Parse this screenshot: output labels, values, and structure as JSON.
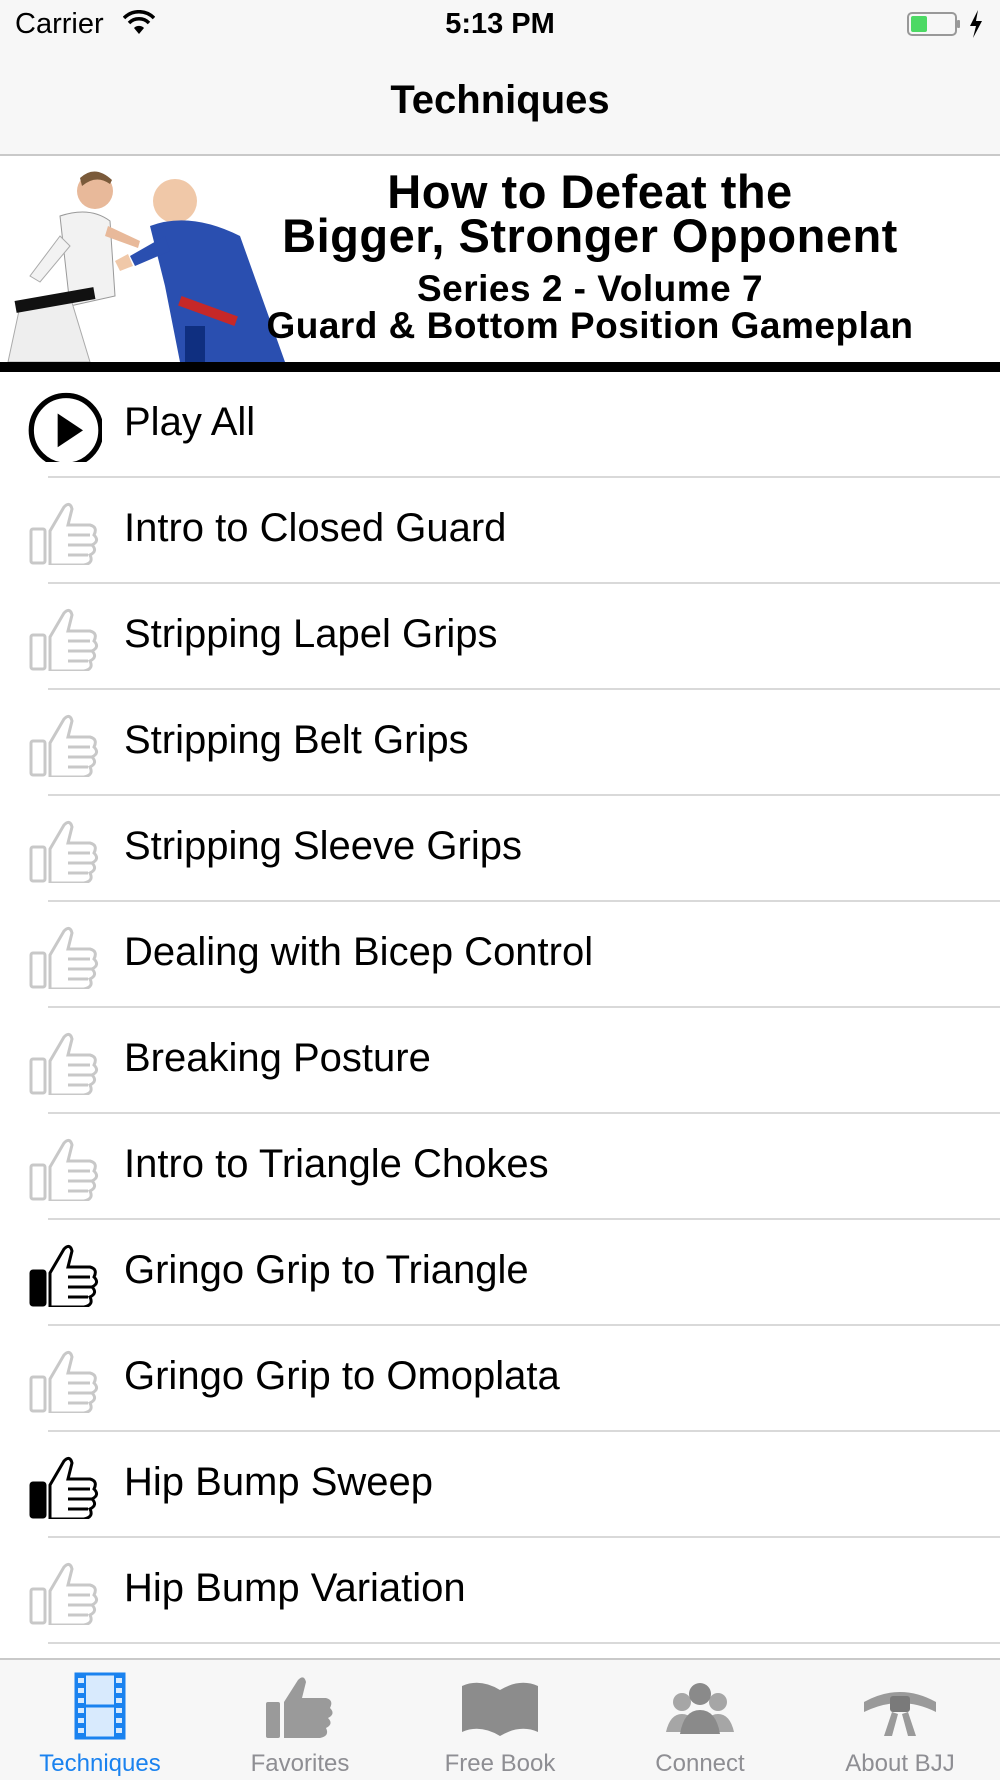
{
  "status_bar": {
    "carrier": "Carrier",
    "time": "5:13 PM"
  },
  "nav": {
    "title": "Techniques"
  },
  "banner": {
    "line1": "How to Defeat the",
    "line2": "Bigger, Stronger Opponent",
    "line3": "Series 2 - Volume 7",
    "line4": "Guard & Bottom Position Gameplan"
  },
  "list": {
    "play_all": "Play All",
    "items": [
      {
        "label": "Intro to Closed Guard",
        "favorite": false
      },
      {
        "label": "Stripping Lapel Grips",
        "favorite": false
      },
      {
        "label": "Stripping Belt Grips",
        "favorite": false
      },
      {
        "label": "Stripping Sleeve Grips",
        "favorite": false
      },
      {
        "label": "Dealing with Bicep Control",
        "favorite": false
      },
      {
        "label": "Breaking Posture",
        "favorite": false
      },
      {
        "label": "Intro to Triangle Chokes",
        "favorite": false
      },
      {
        "label": "Gringo Grip to Triangle",
        "favorite": true
      },
      {
        "label": "Gringo Grip to Omoplata",
        "favorite": false
      },
      {
        "label": "Hip Bump Sweep",
        "favorite": true
      },
      {
        "label": "Hip Bump Variation",
        "favorite": false
      }
    ]
  },
  "tab_bar": {
    "tabs": [
      {
        "label": "Techniques",
        "icon": "film-icon",
        "active": true
      },
      {
        "label": "Favorites",
        "icon": "thumbs-up-icon",
        "active": false
      },
      {
        "label": "Free Book",
        "icon": "book-icon",
        "active": false
      },
      {
        "label": "Connect",
        "icon": "people-icon",
        "active": false
      },
      {
        "label": "About BJJ",
        "icon": "belt-icon",
        "active": false
      }
    ]
  },
  "colors": {
    "accent": "#1a82ef",
    "inactive": "#8e8e93",
    "bar_bg": "#f7f7f7",
    "separator": "#d9d9d9",
    "favorite_on": "#000000",
    "favorite_off": "#c8c8c8"
  }
}
